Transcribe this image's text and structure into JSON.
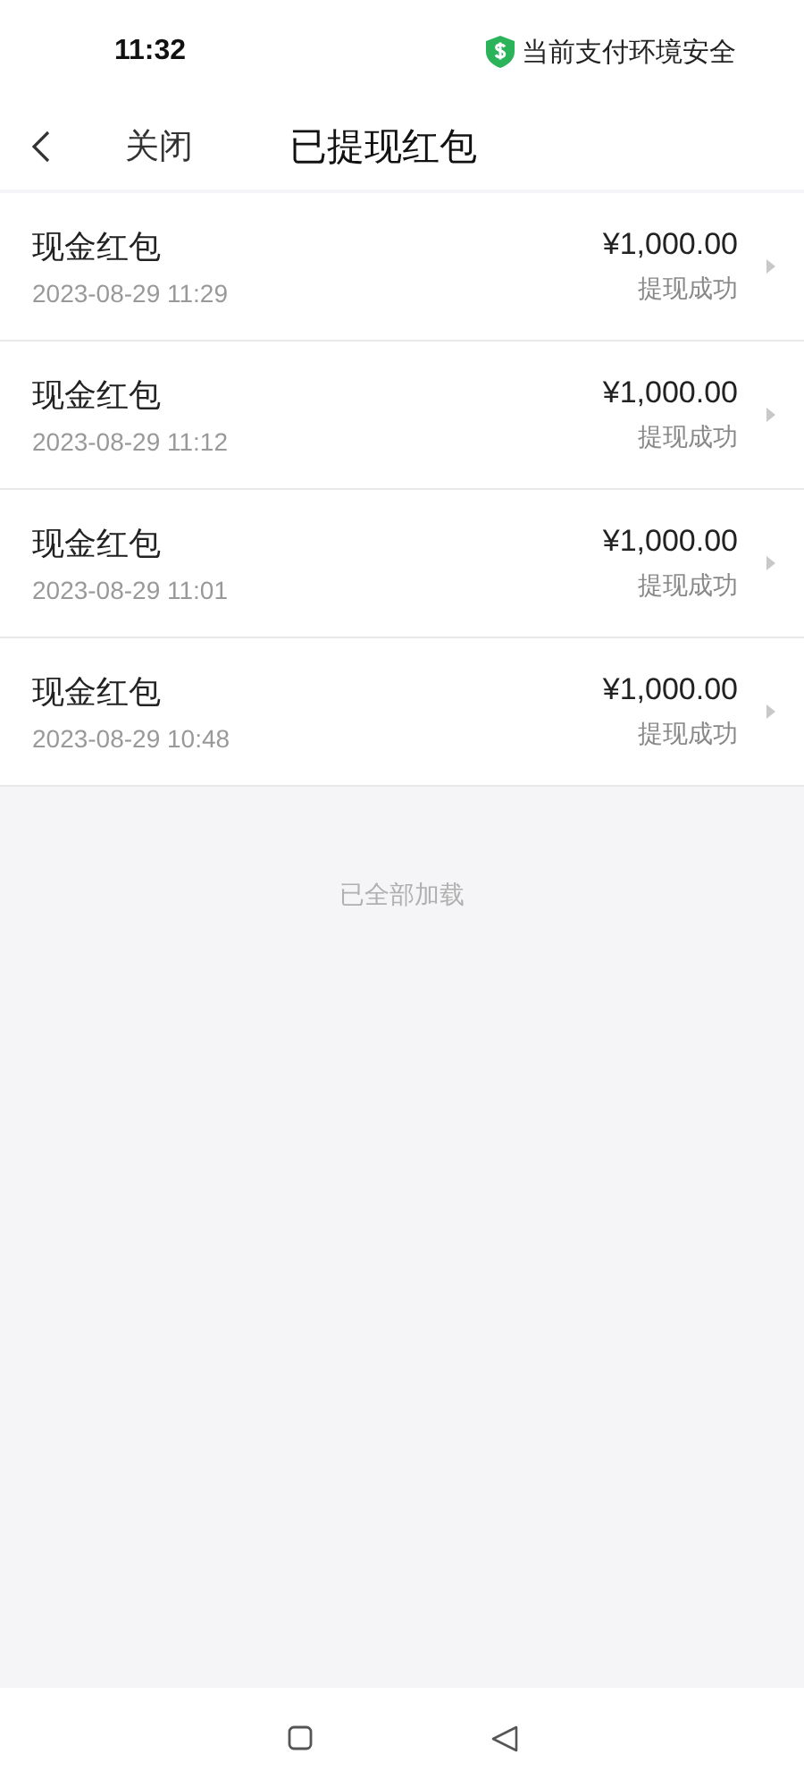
{
  "status_bar": {
    "time": "11:32",
    "security": "当前支付环境安全"
  },
  "header": {
    "close": "关闭",
    "title": "已提现红包"
  },
  "records": [
    {
      "name": "现金红包",
      "time": "2023-08-29 11:29",
      "amount": "¥1,000.00",
      "status": "提现成功"
    },
    {
      "name": "现金红包",
      "time": "2023-08-29 11:12",
      "amount": "¥1,000.00",
      "status": "提现成功"
    },
    {
      "name": "现金红包",
      "time": "2023-08-29 11:01",
      "amount": "¥1,000.00",
      "status": "提现成功"
    },
    {
      "name": "现金红包",
      "time": "2023-08-29 10:48",
      "amount": "¥1,000.00",
      "status": "提现成功"
    }
  ],
  "footer_note": "已全部加载",
  "system_nav": [
    {
      "kind": "recents"
    },
    {
      "kind": "back"
    }
  ]
}
